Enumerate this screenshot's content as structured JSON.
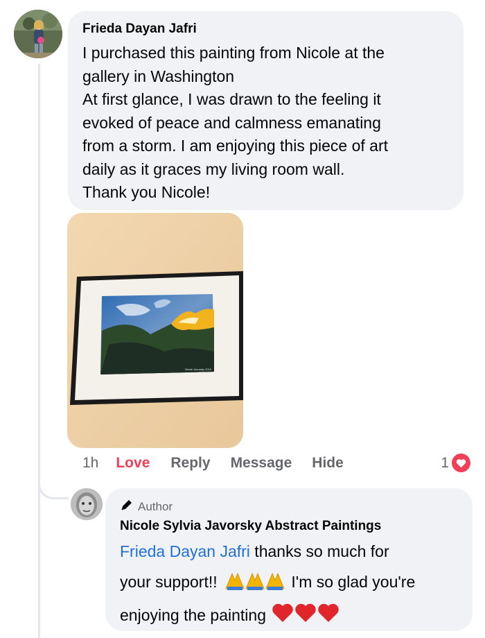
{
  "comment": {
    "author": "Frieda Dayan Jafri",
    "text": "I purchased this painting from Nicole at the\ngallery in Washington\nAt first glance, I was drawn to the feeling it\nevoked of peace and calmness emanating\nfrom a storm. I am enjoying this piece of art\ndaily as it graces my living room wall.\nThank you Nicole!",
    "photo_alt": "Framed abstract painting hanging on a wall",
    "painting_signature": "Nicole Javorsky 2019",
    "actions": {
      "time": "1h",
      "love": "Love",
      "reply": "Reply",
      "message": "Message",
      "hide": "Hide"
    },
    "reaction_count": "1",
    "reaction_icon": "heart-icon"
  },
  "reply": {
    "badge": "Author",
    "badge_icon": "pen-icon",
    "author": "Nicole Sylvia Javorsky Abstract Paintings",
    "mention": "Frieda Dayan Jafri",
    "text_part1": " thanks so much for",
    "text_part2": "your support!! ",
    "emoji_prayer": "praying-hands-emoji x3",
    "text_part3": " I'm so glad you're",
    "text_part4": "enjoying the painting ",
    "emoji_hearts": "red-heart-emoji x3"
  },
  "colors": {
    "bubble": "#f0f2f5",
    "love_red": "#f33e58",
    "mention_blue": "#216fdb",
    "secondary_text": "#65676b"
  }
}
